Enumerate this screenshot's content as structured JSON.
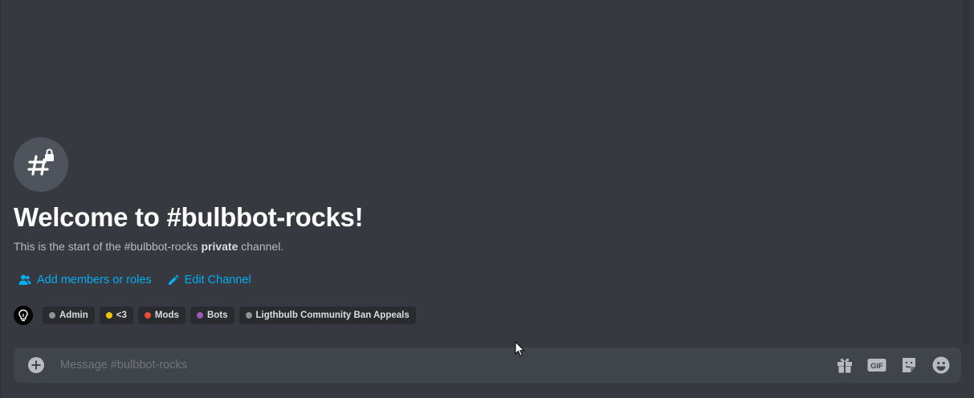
{
  "channel": {
    "name": "#bulbbot-rocks",
    "welcome_title": "Welcome to #bulbbot-rocks!",
    "subtitle_prefix": "This is the start of the #bulbbot-rocks ",
    "subtitle_emphasis": "private",
    "subtitle_suffix": " channel."
  },
  "actions": {
    "add_members_label": "Add members or roles",
    "edit_channel_label": "Edit Channel",
    "add_members_icon": "add-person-icon",
    "edit_channel_icon": "pencil-icon"
  },
  "roles": [
    {
      "name": "Admin",
      "color": "#8e9297"
    },
    {
      "name": "<3",
      "color": "#f1c40f"
    },
    {
      "name": "Mods",
      "color": "#e74c3c"
    },
    {
      "name": "Bots",
      "color": "#9b59b6"
    },
    {
      "name": "Ligthbulb Community Ban Appeals",
      "color": "#8e9297"
    }
  ],
  "composer": {
    "placeholder": "Message #bulbbot-rocks",
    "buttons": [
      "gift-icon",
      "gif-icon",
      "sticker-icon",
      "emoji-icon"
    ],
    "gif_label": "GIF"
  },
  "colors": {
    "background": "#36393f",
    "link": "#00aff4",
    "composer_bg": "#40444b"
  }
}
